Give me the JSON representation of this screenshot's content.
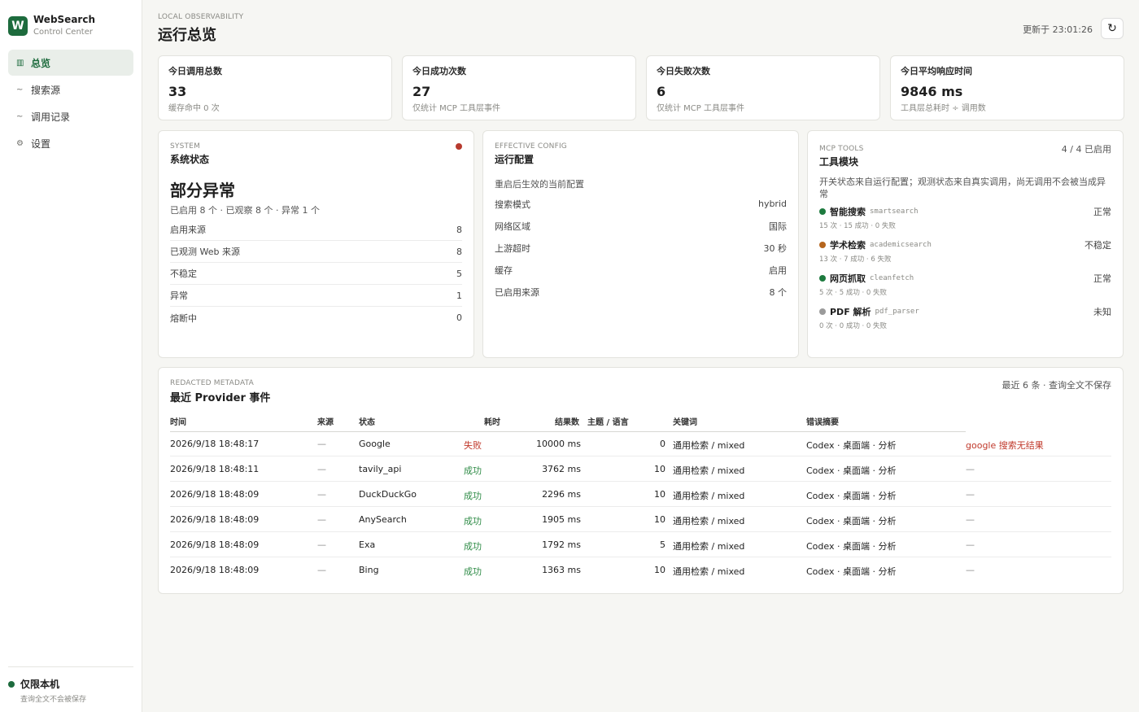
{
  "brand": {
    "logo": "W",
    "name": "WebSearch",
    "subtitle": "Control Center"
  },
  "nav": [
    {
      "label": "总览",
      "icon": "grid-icon",
      "glyph": "▥",
      "active": true
    },
    {
      "label": "搜索源",
      "icon": "source-icon",
      "glyph": "~",
      "active": false
    },
    {
      "label": "调用记录",
      "icon": "log-icon",
      "glyph": "~",
      "active": false
    },
    {
      "label": "设置",
      "icon": "gear-icon",
      "glyph": "⚙",
      "active": false
    }
  ],
  "sidebar_footer": {
    "title": "仅限本机",
    "subtitle": "查询全文不会被保存",
    "dot_color": "#1d6b3d"
  },
  "header": {
    "eyebrow": "LOCAL OBSERVABILITY",
    "title": "运行总览",
    "updated": "更新于 23:01:26",
    "refresh_icon": "↻"
  },
  "stats": [
    {
      "label": "今日调用总数",
      "value": "33",
      "note": "缓存命中 0 次"
    },
    {
      "label": "今日成功次数",
      "value": "27",
      "note": "仅统计 MCP 工具层事件"
    },
    {
      "label": "今日失败次数",
      "value": "6",
      "note": "仅统计 MCP 工具层事件"
    },
    {
      "label": "今日平均响应时间",
      "value": "9846 ms",
      "note": "工具层总耗时 ÷ 调用数"
    }
  ],
  "system": {
    "eyebrow": "SYSTEM",
    "title": "系统状态",
    "status": "部分异常",
    "summary": "已启用 8 个 · 已观察 8 个 · 异常 1 个",
    "status_color": "#b73a2e",
    "rows": [
      {
        "k": "启用来源",
        "v": "8"
      },
      {
        "k": "已观测 Web 来源",
        "v": "8"
      },
      {
        "k": "不稳定",
        "v": "5"
      },
      {
        "k": "异常",
        "v": "1"
      },
      {
        "k": "熔断中",
        "v": "0"
      }
    ]
  },
  "config": {
    "eyebrow": "EFFECTIVE CONFIG",
    "title": "运行配置",
    "intro": "重启后生效的当前配置",
    "rows": [
      {
        "k": "搜索模式",
        "v": "hybrid"
      },
      {
        "k": "网络区域",
        "v": "国际"
      },
      {
        "k": "上游超时",
        "v": "30 秒"
      },
      {
        "k": "缓存",
        "v": "启用"
      },
      {
        "k": "已启用来源",
        "v": "8 个"
      }
    ]
  },
  "tools": {
    "eyebrow": "MCP TOOLS",
    "title": "工具模块",
    "count": "4 / 4 已启用",
    "desc": "开关状态来自运行配置；观测状态来自真实调用，尚无调用不会被当成异常",
    "items": [
      {
        "name": "智能搜索",
        "code": "smartsearch",
        "state": "正常",
        "stats": "15 次 · 15 成功 · 0 失败",
        "color": "#1d7a3e"
      },
      {
        "name": "学术检索",
        "code": "academicsearch",
        "state": "不稳定",
        "stats": "13 次 · 7 成功 · 6 失败",
        "color": "#b5651d"
      },
      {
        "name": "网页抓取",
        "code": "cleanfetch",
        "state": "正常",
        "stats": "5 次 · 5 成功 · 0 失败",
        "color": "#1d7a3e"
      },
      {
        "name": "PDF 解析",
        "code": "pdf_parser",
        "state": "未知",
        "stats": "0 次 · 0 成功 · 0 失败",
        "color": "#9a9a9a"
      }
    ]
  },
  "events": {
    "eyebrow": "REDACTED METADATA",
    "title": "最近 Provider 事件",
    "meta": "最近 6 条 · 查询全文不保存",
    "columns": [
      "时间",
      "来源",
      "状态",
      "耗时",
      "结果数",
      "主题 / 语言",
      "关键词",
      "错误摘要"
    ],
    "rows": [
      {
        "time": "2026/9/18 18:48:17",
        "src": "—",
        "provider": "Google",
        "status": "失败",
        "ok": false,
        "dur": "10000 ms",
        "count": "0",
        "topic": "通用检索 / mixed",
        "kw": "Codex · 桌面端 · 分析",
        "err": "google 搜索无结果"
      },
      {
        "time": "2026/9/18 18:48:11",
        "src": "—",
        "provider": "tavily_api",
        "status": "成功",
        "ok": true,
        "dur": "3762 ms",
        "count": "10",
        "topic": "通用检索 / mixed",
        "kw": "Codex · 桌面端 · 分析",
        "err": "—"
      },
      {
        "time": "2026/9/18 18:48:09",
        "src": "—",
        "provider": "DuckDuckGo",
        "status": "成功",
        "ok": true,
        "dur": "2296 ms",
        "count": "10",
        "topic": "通用检索 / mixed",
        "kw": "Codex · 桌面端 · 分析",
        "err": "—"
      },
      {
        "time": "2026/9/18 18:48:09",
        "src": "—",
        "provider": "AnySearch",
        "status": "成功",
        "ok": true,
        "dur": "1905 ms",
        "count": "10",
        "topic": "通用检索 / mixed",
        "kw": "Codex · 桌面端 · 分析",
        "err": "—"
      },
      {
        "time": "2026/9/18 18:48:09",
        "src": "—",
        "provider": "Exa",
        "status": "成功",
        "ok": true,
        "dur": "1792 ms",
        "count": "5",
        "topic": "通用检索 / mixed",
        "kw": "Codex · 桌面端 · 分析",
        "err": "—"
      },
      {
        "time": "2026/9/18 18:48:09",
        "src": "—",
        "provider": "Bing",
        "status": "成功",
        "ok": true,
        "dur": "1363 ms",
        "count": "10",
        "topic": "通用检索 / mixed",
        "kw": "Codex · 桌面端 · 分析",
        "err": "—"
      }
    ]
  }
}
